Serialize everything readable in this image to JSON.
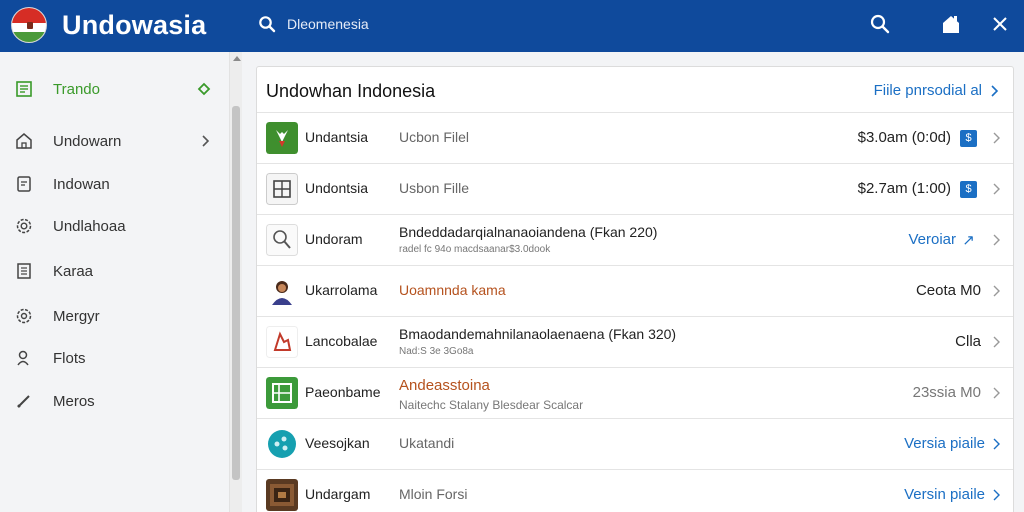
{
  "header": {
    "app_title": "Undowasia",
    "search_text": "Dleomenesia",
    "bg_color": "#0f4a9c"
  },
  "sidebar": {
    "items": [
      {
        "label": "Trando",
        "icon": "list-icon",
        "active": true
      },
      {
        "label": "Undowarn",
        "icon": "home-icon",
        "has_chevron": true
      },
      {
        "label": "Indowan",
        "icon": "document-icon"
      },
      {
        "label": "Undlahoaa",
        "icon": "gear-icon"
      },
      {
        "label": "Karaa",
        "icon": "page-icon"
      },
      {
        "label": "Mergyr",
        "icon": "settings-icon"
      },
      {
        "label": "Flots",
        "icon": "person-icon"
      },
      {
        "label": "Meros",
        "icon": "pencil-icon"
      }
    ]
  },
  "panel": {
    "title": "Undowhan Indonesia",
    "link_label": "Fiile pnrsodial al"
  },
  "rows": [
    {
      "name": "Undantsia",
      "desc": "Ucbon Filel",
      "right": "$3.0am (0:0d)",
      "badge": "$",
      "thumb": "green-figure"
    },
    {
      "name": "Undontsia",
      "desc": "Usbon Fille",
      "right": "$2.7am (1:00)",
      "badge": "$",
      "thumb": "grid-box"
    },
    {
      "name": "Undoram",
      "title": "Bndeddadarqialnanaoiandena (Fkan 220)",
      "sub": "radel fc 94o macdsaanar$3.0dook",
      "right": "Veroiar",
      "badge": "↗",
      "thumb": "magnifier"
    },
    {
      "name": "Ukarrolama",
      "desc": "Uoamnnda kama",
      "right": "Ceota M0",
      "thumb": "portrait"
    },
    {
      "name": "Lancobalae",
      "title": "Bmaodandemahnilanaolaenaena (Fkan 320)",
      "sub": "Nad:S 3e 3Go8a",
      "right": "Clla",
      "thumb": "red-figure"
    },
    {
      "name": "Paeonbame",
      "title": "Andeasstoina",
      "sub": "Naitechc Stalany Blesdear Scalcar",
      "right": "23ssia M0",
      "thumb": "green-grid"
    },
    {
      "name": "Veesojkan",
      "desc": "Ukatandi",
      "right": "Versia piaile",
      "thumb": "teal-circle"
    },
    {
      "name": "Undargam",
      "desc": "Mloin Forsi",
      "right": "Versin piaile",
      "thumb": "photo"
    }
  ]
}
